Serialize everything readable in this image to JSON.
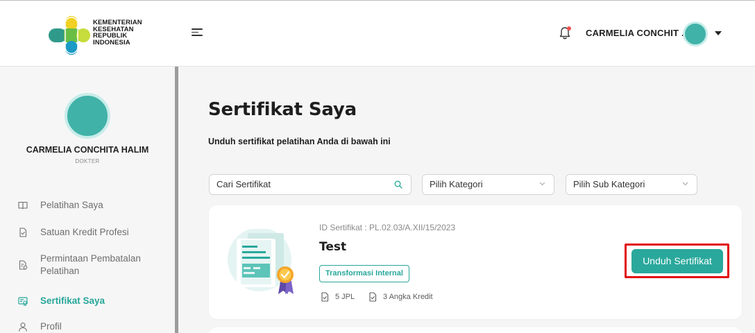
{
  "header": {
    "logo_lines": [
      "KEMENTERIAN",
      "KESEHATAN",
      "REPUBLIK",
      "INDONESIA"
    ],
    "user_name": "CARMELIA CONCHIT ...",
    "notification_icon": "bell-icon",
    "menu_icon": "hamburger-menu-icon"
  },
  "profile": {
    "name": "CARMELIA CONCHITA HALIM",
    "role": "DOKTER"
  },
  "sidebar": {
    "items": [
      {
        "label": "Pelatihan Saya",
        "icon": "book-icon",
        "active": false
      },
      {
        "label": "Satuan Kredit Profesi",
        "icon": "document-check-icon",
        "active": false
      },
      {
        "label_lines": [
          "Permintaan Pembatalan",
          "Pelatihan"
        ],
        "icon": "document-cancel-icon",
        "active": false
      },
      {
        "label": "Sertifikat Saya",
        "icon": "certificate-icon",
        "active": true
      },
      {
        "label": "Profil",
        "icon": "user-icon",
        "active": false
      }
    ]
  },
  "main": {
    "title": "Sertifikat Saya",
    "subtitle": "Unduh sertifikat pelatihan Anda di bawah ini",
    "search": {
      "value": "Cari Sertifikat",
      "icon": "search-icon"
    },
    "category_select": {
      "value": "Pilih Kategori",
      "icon": "chevron-down-icon"
    },
    "subcategory_select": {
      "value": "Pilih Sub Kategori",
      "icon": "chevron-down-icon"
    }
  },
  "certificate": {
    "id_text": "ID Sertifikat : PL.02.03/A.XII/15/2023",
    "title": "Test",
    "badge": "Transformasi Internal",
    "jpl": "5 JPL",
    "kredit": "3 Angka Kredit",
    "download_label": "Unduh Sertifikat",
    "illustration": "certificate-illustration"
  },
  "colors": {
    "accent": "#2aa89c",
    "highlight": "#e20b0b",
    "avatar": "#41b2a8"
  }
}
